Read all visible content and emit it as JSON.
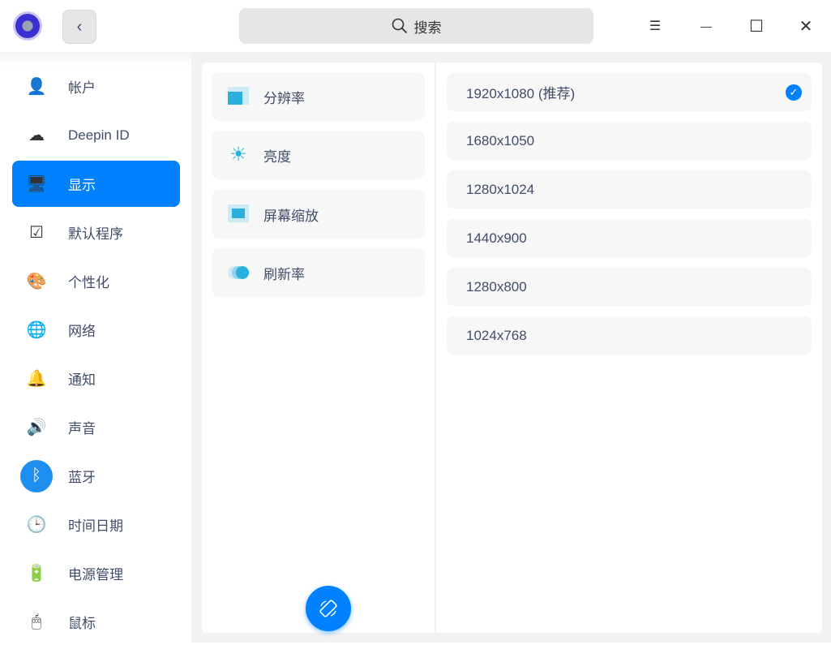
{
  "titlebar": {
    "search_placeholder": "搜索",
    "back": "‹",
    "menu": "☰",
    "minimize": "—",
    "maximize": "☐",
    "close": "✕"
  },
  "sidebar": {
    "items": [
      {
        "label": "帐户",
        "icon": "user-icon",
        "glyph": "👤",
        "bg": "transparent"
      },
      {
        "label": "Deepin ID",
        "icon": "cloud-icon",
        "glyph": "☁",
        "bg": "transparent"
      },
      {
        "label": "显示",
        "icon": "display-icon",
        "glyph": "🖥",
        "bg": "transparent",
        "active": true
      },
      {
        "label": "默认程序",
        "icon": "default-apps-icon",
        "glyph": "☑",
        "bg": "transparent"
      },
      {
        "label": "个性化",
        "icon": "palette-icon",
        "glyph": "🎨",
        "bg": "transparent"
      },
      {
        "label": "网络",
        "icon": "network-icon",
        "glyph": "🌐",
        "bg": "transparent"
      },
      {
        "label": "通知",
        "icon": "bell-icon",
        "glyph": "🔔",
        "bg": "transparent"
      },
      {
        "label": "声音",
        "icon": "speaker-icon",
        "glyph": "🔊",
        "bg": "transparent"
      },
      {
        "label": "蓝牙",
        "icon": "bluetooth-icon",
        "glyph": "ᛒ",
        "bg": "#1e8ef0"
      },
      {
        "label": "时间日期",
        "icon": "clock-icon",
        "glyph": "🕒",
        "bg": "transparent"
      },
      {
        "label": "电源管理",
        "icon": "battery-icon",
        "glyph": "🔋",
        "bg": "transparent"
      },
      {
        "label": "鼠标",
        "icon": "mouse-icon",
        "glyph": "🖱",
        "bg": "transparent"
      }
    ]
  },
  "display_menu": [
    "分辨率",
    "亮度",
    "屏幕缩放",
    "刷新率"
  ],
  "resolutions": {
    "items": [
      "1920x1080 (推荐)",
      "1680x1050",
      "1280x1024",
      "1440x900",
      "1280x800",
      "1024x768"
    ],
    "selected": 0
  },
  "colors": {
    "accent": "#0081ff",
    "icon_blue": "#2bb0dd"
  }
}
